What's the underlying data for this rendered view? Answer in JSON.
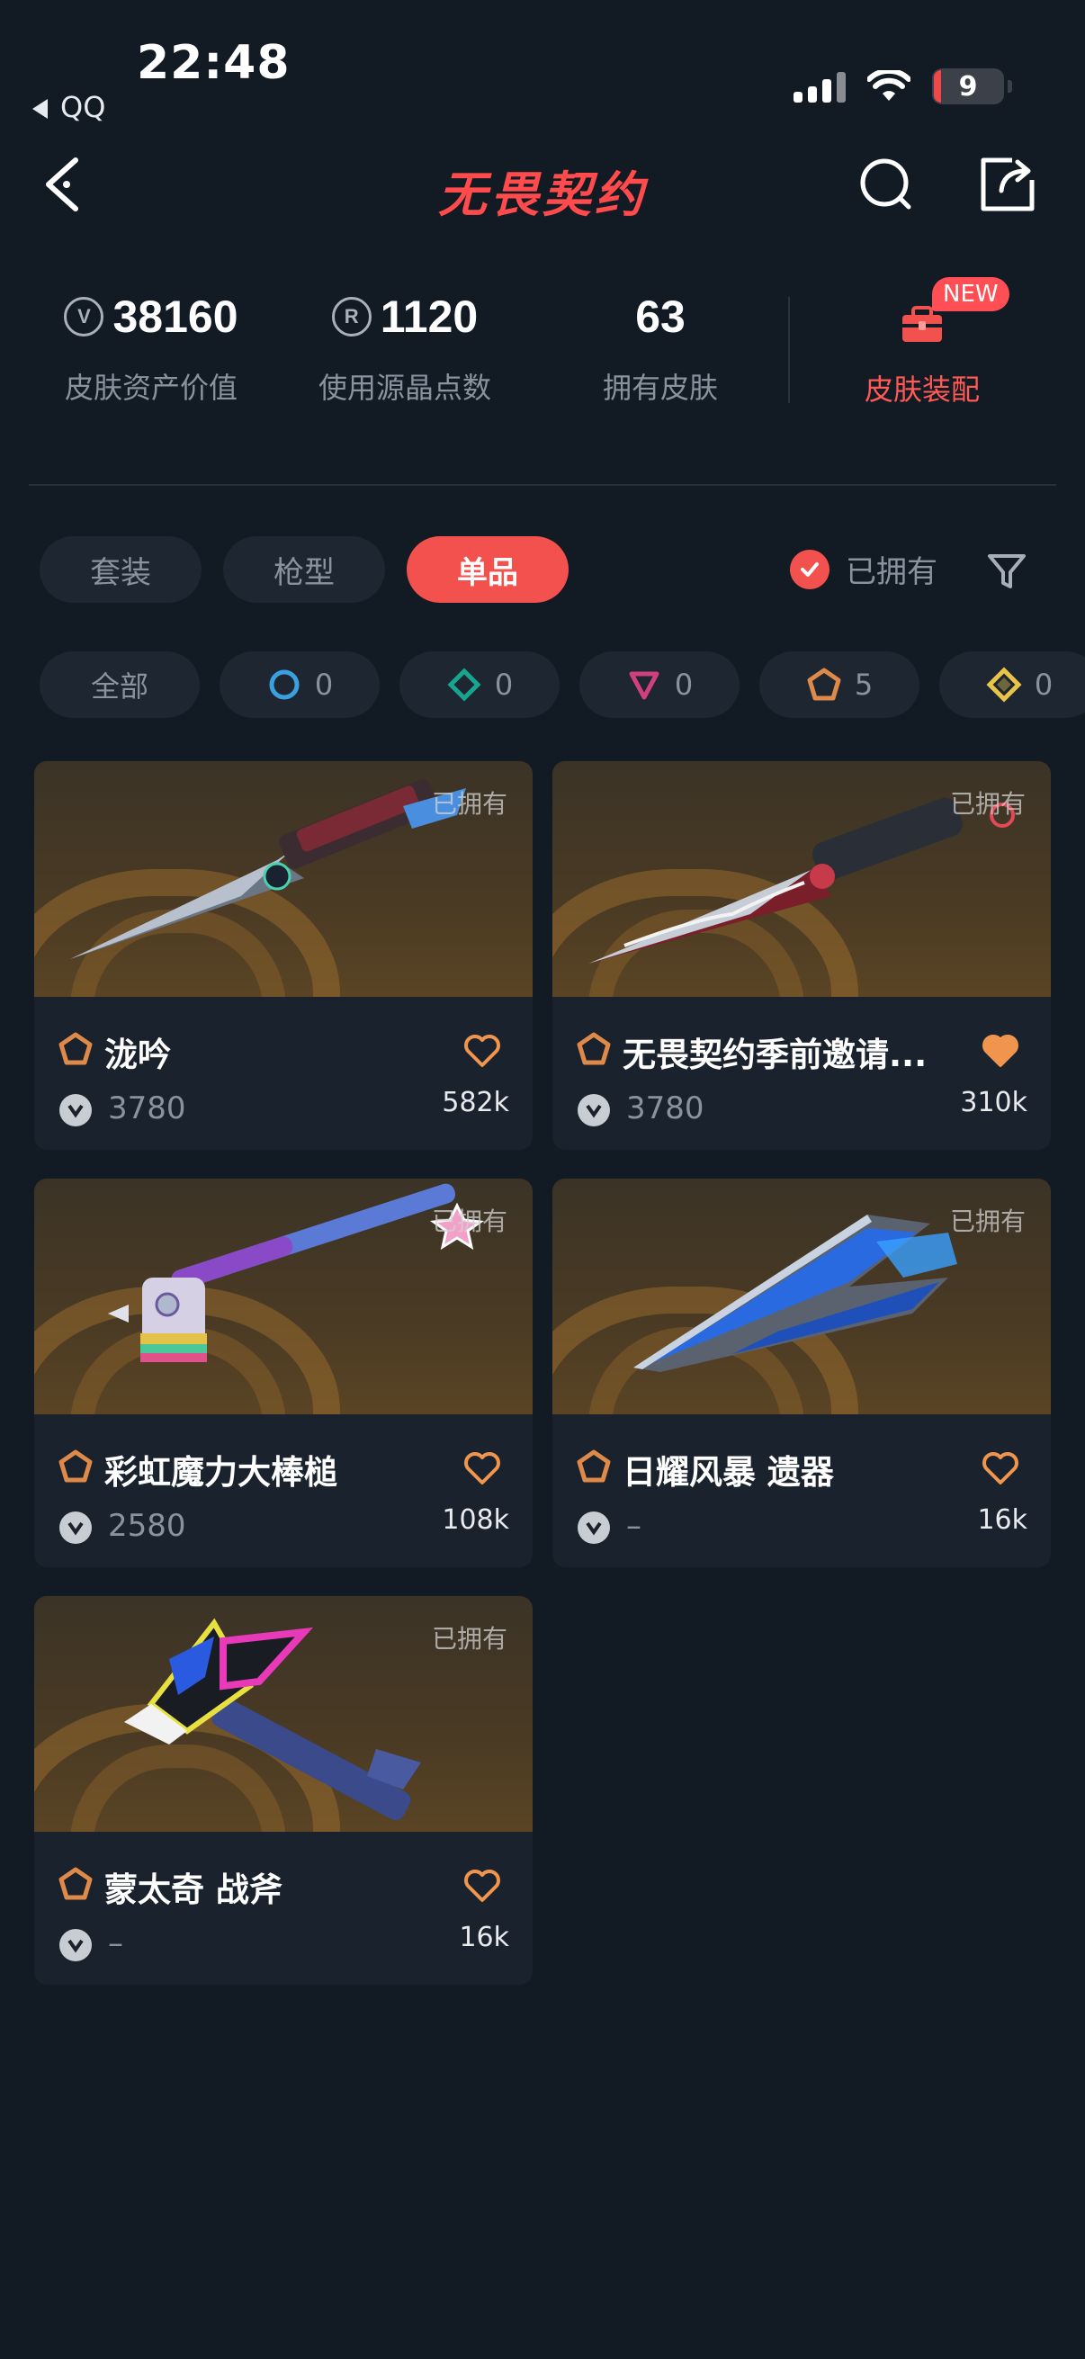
{
  "status_bar": {
    "time": "22:48",
    "back_app": "QQ",
    "battery": "9"
  },
  "nav": {
    "title": "无畏契约"
  },
  "stats": [
    {
      "value": "38160",
      "label": "皮肤资产价值",
      "icon": "vp-icon"
    },
    {
      "value": "1120",
      "label": "使用源晶点数",
      "icon": "radianite-icon"
    },
    {
      "value": "63",
      "label": "拥有皮肤"
    }
  ],
  "equip": {
    "label": "皮肤装配",
    "badge": "NEW"
  },
  "tabs": [
    "套装",
    "枪型",
    "单品"
  ],
  "active_tab": "单品",
  "owned_filter": {
    "label": "已拥有",
    "checked": true
  },
  "chips": [
    {
      "label": "全部"
    },
    {
      "count": "0",
      "tier": "select",
      "color": "#3aa0e0"
    },
    {
      "count": "0",
      "tier": "deluxe",
      "color": "#18a58e"
    },
    {
      "count": "0",
      "tier": "premium",
      "color": "#d0407c"
    },
    {
      "count": "5",
      "tier": "exclusive",
      "color": "#e08a4a"
    },
    {
      "count": "0",
      "tier": "ultra",
      "color": "#e8c54a"
    }
  ],
  "cards": [
    {
      "name": "泷吟",
      "price": "3780",
      "likes": "582k",
      "owned": "已拥有",
      "liked": false
    },
    {
      "name": "无畏契约季前邀请...",
      "price": "3780",
      "likes": "310k",
      "owned": "已拥有",
      "liked": true
    },
    {
      "name": "彩虹魔力大棒槌",
      "price": "2580",
      "likes": "108k",
      "owned": "已拥有",
      "liked": false
    },
    {
      "name": "日耀风暴 遗器",
      "price": "–",
      "likes": "16k",
      "owned": "已拥有",
      "liked": false
    },
    {
      "name": "蒙太奇 战斧",
      "price": "–",
      "likes": "16k",
      "owned": "已拥有",
      "liked": false
    }
  ],
  "colors": {
    "accent": "#f2514d",
    "tier_exclusive": "#e08a4a",
    "background": "#121a24"
  }
}
